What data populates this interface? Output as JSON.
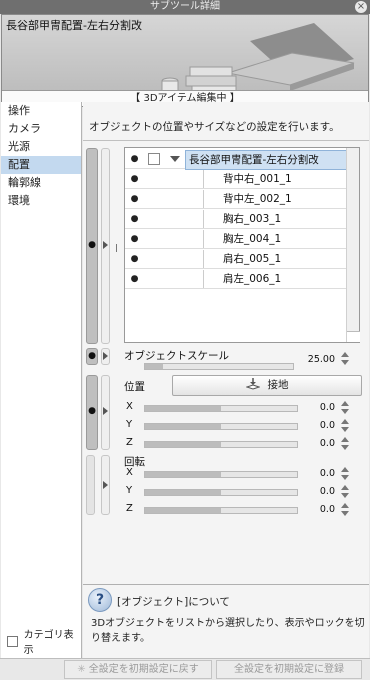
{
  "window": {
    "title": "サブツール詳細",
    "close_label": "×"
  },
  "preview": {
    "title": "長谷部甲冑配置-左右分割改",
    "status": "【 3Dアイテム編集中 】"
  },
  "categories": [
    {
      "label": "操作"
    },
    {
      "label": "カメラ"
    },
    {
      "label": "光源"
    },
    {
      "label": "配置",
      "active": true
    },
    {
      "label": "輪郭線"
    },
    {
      "label": "環境"
    }
  ],
  "category_display_label": "カテゴリ表示",
  "description": "オブジェクトの位置やサイズなどの設定を行います。",
  "objects": {
    "parent": "長谷部甲冑配置-左右分割改",
    "children": [
      "背中右_001_1",
      "背中左_002_1",
      "胸右_003_1",
      "胸左_004_1",
      "肩右_005_1",
      "肩左_006_1"
    ]
  },
  "object_scale": {
    "label": "オブジェクトスケール",
    "value": "25.00",
    "fill": 0.12
  },
  "position": {
    "label": "位置",
    "ground_button": "接地",
    "axes": [
      {
        "label": "X",
        "value": "0.0",
        "fill": 0.5
      },
      {
        "label": "Y",
        "value": "0.0",
        "fill": 0.5
      },
      {
        "label": "Z",
        "value": "0.0",
        "fill": 0.5
      }
    ]
  },
  "rotation": {
    "label": "回転",
    "axes": [
      {
        "label": "X",
        "value": "0.0",
        "fill": 0.5
      },
      {
        "label": "Y",
        "value": "0.0",
        "fill": 0.5
      },
      {
        "label": "Z",
        "value": "0.0",
        "fill": 0.5
      }
    ]
  },
  "help": {
    "title": "[オブジェクト]について",
    "text": "3Dオブジェクトをリストから選択したり、表示やロックを切り替えます。"
  },
  "footer": {
    "reset_button": "全設定を初期設定に戻す",
    "register_button": "全設定を初期設定に登録"
  },
  "colors": {
    "selection": "#c3d9ef",
    "titlebar": "#6f6f6f"
  }
}
